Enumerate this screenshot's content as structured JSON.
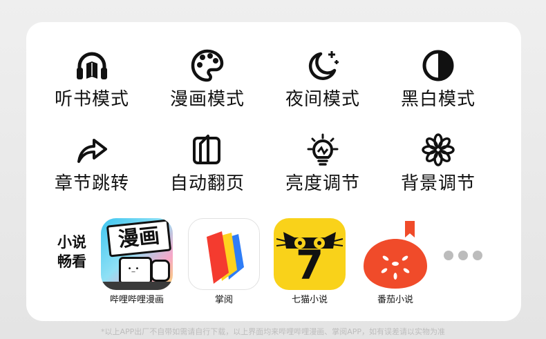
{
  "modes": [
    {
      "label": "听书模式",
      "icon": "headphones-book-icon"
    },
    {
      "label": "漫画模式",
      "icon": "palette-icon"
    },
    {
      "label": "夜间模式",
      "icon": "moon-stars-icon"
    },
    {
      "label": "黑白模式",
      "icon": "half-circle-contrast-icon"
    },
    {
      "label": "章节跳转",
      "icon": "forward-arrow-icon"
    },
    {
      "label": "自动翻页",
      "icon": "page-flip-icon"
    },
    {
      "label": "亮度调节",
      "icon": "light-bulb-icon"
    },
    {
      "label": "背景调节",
      "icon": "flower-icon"
    }
  ],
  "apps_section": {
    "title_line1": "小说",
    "title_line2": "畅看",
    "apps": [
      {
        "name": "哔哩哔哩漫画",
        "icon": "bilibili-manga-app-icon",
        "tile_text": "漫画"
      },
      {
        "name": "掌阅",
        "icon": "zhangyue-app-icon"
      },
      {
        "name": "七猫小说",
        "icon": "qimao-app-icon",
        "tile_text": "7"
      },
      {
        "name": "番茄小说",
        "icon": "fanqie-app-icon"
      }
    ],
    "more": "more-dots-icon"
  },
  "footnote": "*以上APP出厂不自带如需请自行下载，以上界面均来哔哩哔哩漫画、掌阅APP，如有误差请以实物为准",
  "colors": {
    "icon": "#111111",
    "card": "#ffffff",
    "background": "#e9e9e9",
    "qimao_yellow": "#f9d21a",
    "fanqie_red": "#f04b2a",
    "dots": "#bcbcbc"
  }
}
